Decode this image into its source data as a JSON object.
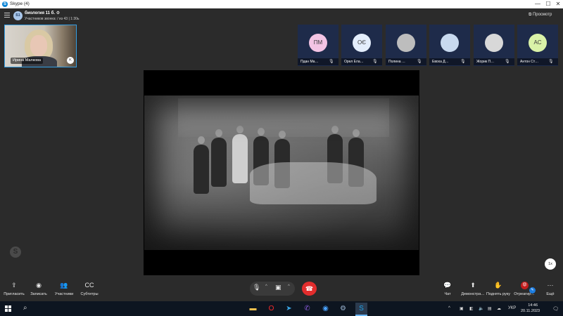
{
  "window": {
    "title": "Skype (4)",
    "minimize": "—",
    "maximize": "☐",
    "close": "✕"
  },
  "call": {
    "group_avatar": "Б1",
    "title": "биология 11 б.  ⚙",
    "subtitle": "Участников звонка: / из 43 | 1:30ь",
    "preview_label": "⧉ Просмотр"
  },
  "self_view": {
    "name": "Ирина Малкова",
    "pip": "⇱"
  },
  "participants": [
    {
      "initials": "ПМ",
      "name": "Пдан Ма…",
      "color": "#f3c4e4",
      "mic": "🎙"
    },
    {
      "initials": "ОЄ",
      "name": "Орел Ела…",
      "color": "#e4eefc",
      "mic": "🎙"
    },
    {
      "initials": "",
      "name": "Полина …",
      "color": "#bdbdbd",
      "mic": "🎙"
    },
    {
      "initials": "",
      "name": "Евоха Д…",
      "color": "#c8d9ef",
      "mic": "🎙"
    },
    {
      "initials": "",
      "name": "Жорик П…",
      "color": "#d8d8d8",
      "mic": "🎙"
    },
    {
      "initials": "АС",
      "name": "Антон Ст…",
      "color": "#d9f2a8",
      "mic": "🎙"
    }
  ],
  "speed_badge": "1x",
  "controls_left": [
    {
      "id": "invite",
      "icon": "⇪",
      "label": "Пригласить"
    },
    {
      "id": "record",
      "icon": "◉",
      "label": "Записать"
    },
    {
      "id": "participants",
      "icon": "👥",
      "label": "Участники"
    },
    {
      "id": "subtitles",
      "icon": "CC",
      "label": "Субтитры"
    }
  ],
  "controls_right": [
    {
      "id": "chat",
      "icon": "💬",
      "label": "Чат"
    },
    {
      "id": "share",
      "icon": "⬆",
      "label": "Демонстра…"
    },
    {
      "id": "raise_hand",
      "icon": "✋",
      "label": "Поднять руку"
    },
    {
      "id": "react",
      "icon": "",
      "label": "Отреагир…"
    },
    {
      "id": "more",
      "icon": "···",
      "label": "Ещё"
    }
  ],
  "center_controls": {
    "mic": "🎙",
    "cam": "▣",
    "caret": "^",
    "hangup": "☎"
  },
  "taskbar": {
    "apps": [
      {
        "name": "explorer",
        "icon": "▬",
        "color": "#f2c14e"
      },
      {
        "name": "opera",
        "icon": "O",
        "color": "#ff2a2a"
      },
      {
        "name": "telegram",
        "icon": "➤",
        "color": "#3aa6e5"
      },
      {
        "name": "viber",
        "icon": "✆",
        "color": "#8a5ad9"
      },
      {
        "name": "chrome",
        "icon": "◉",
        "color": "#4aa3ff"
      },
      {
        "name": "steam",
        "icon": "⚙",
        "color": "#9db7d4"
      },
      {
        "name": "skype",
        "icon": "S",
        "color": "#1fa3e8"
      }
    ],
    "tray": {
      "chevron": "^",
      "keyboard_lang": "УКР",
      "time": "14:46",
      "date": "20.11.2023"
    }
  }
}
